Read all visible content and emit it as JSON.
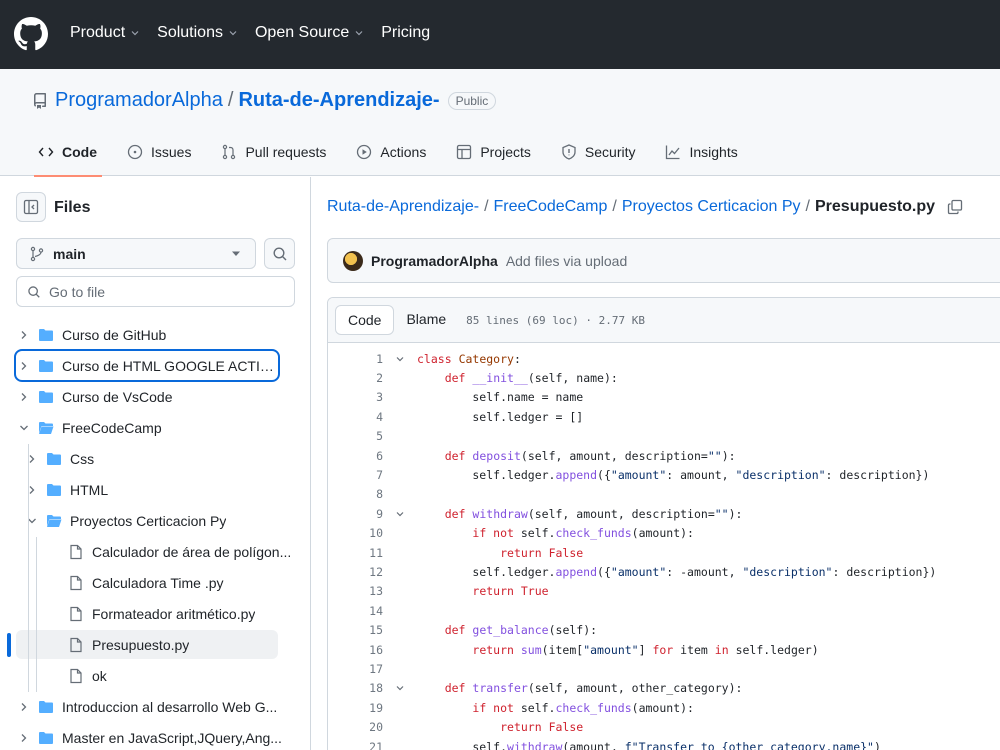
{
  "header": {
    "nav": [
      {
        "label": "Product",
        "dropdown": true
      },
      {
        "label": "Solutions",
        "dropdown": true
      },
      {
        "label": "Open Source",
        "dropdown": true
      },
      {
        "label": "Pricing",
        "dropdown": false
      }
    ]
  },
  "repo": {
    "owner": "ProgramadorAlpha",
    "separator": "/",
    "name": "Ruta-de-Aprendizaje-",
    "visibility": "Public"
  },
  "tabs": [
    {
      "label": "Code",
      "icon": "code-icon",
      "active": true
    },
    {
      "label": "Issues",
      "icon": "issue-icon"
    },
    {
      "label": "Pull requests",
      "icon": "pull-request-icon"
    },
    {
      "label": "Actions",
      "icon": "actions-icon"
    },
    {
      "label": "Projects",
      "icon": "projects-icon"
    },
    {
      "label": "Security",
      "icon": "shield-icon"
    },
    {
      "label": "Insights",
      "icon": "graph-icon"
    }
  ],
  "sidebar": {
    "title": "Files",
    "branch": "main",
    "goto_placeholder": "Go to file",
    "tree": [
      {
        "label": "Curso de GitHub",
        "type": "folder",
        "depth": 0,
        "expanded": false
      },
      {
        "label": "Curso de HTML GOOGLE ACTIVE",
        "type": "folder",
        "depth": 0,
        "expanded": false,
        "focused": true
      },
      {
        "label": "Curso de VsCode",
        "type": "folder",
        "depth": 0,
        "expanded": false
      },
      {
        "label": "FreeCodeCamp",
        "type": "folder",
        "depth": 0,
        "expanded": true
      },
      {
        "label": "Css",
        "type": "folder",
        "depth": 1,
        "expanded": false
      },
      {
        "label": "HTML",
        "type": "folder",
        "depth": 1,
        "expanded": false
      },
      {
        "label": "Proyectos Certicacion Py",
        "type": "folder",
        "depth": 1,
        "expanded": true
      },
      {
        "label": "Calculador de área de polígon...",
        "type": "file",
        "depth": 2
      },
      {
        "label": "Calculadora Time .py",
        "type": "file",
        "depth": 2
      },
      {
        "label": "Formateador aritmético.py",
        "type": "file",
        "depth": 2
      },
      {
        "label": "Presupuesto.py",
        "type": "file",
        "depth": 2,
        "selected": true
      },
      {
        "label": "ok",
        "type": "file",
        "depth": 2
      },
      {
        "label": "Introduccion al desarrollo Web G...",
        "type": "folder",
        "depth": 0,
        "expanded": false
      },
      {
        "label": "Master en JavaScript,JQuery,Ang...",
        "type": "folder",
        "depth": 0,
        "expanded": false
      }
    ]
  },
  "breadcrumb": {
    "parts": [
      "Ruta-de-Aprendizaje-",
      "FreeCodeCamp",
      "Proyectos Certicacion Py"
    ],
    "separator": "/",
    "current": "Presupuesto.py"
  },
  "commit": {
    "author": "ProgramadorAlpha",
    "message": "Add files via upload"
  },
  "code_view": {
    "view_code_label": "Code",
    "view_blame_label": "Blame",
    "file_info": "85 lines (69 loc) · 2.77 KB",
    "lines": [
      {
        "n": "1",
        "fold": true,
        "html": "<span class='kw'>class</span> <span class='cls'>Category</span>:"
      },
      {
        "n": "2",
        "fold": false,
        "html": "    <span class='kw'>def</span> <span class='fn'>__init__</span>(self, name):"
      },
      {
        "n": "3",
        "fold": false,
        "html": "        self.name = name"
      },
      {
        "n": "4",
        "fold": false,
        "html": "        self.ledger = []"
      },
      {
        "n": "5",
        "fold": false,
        "html": ""
      },
      {
        "n": "6",
        "fold": false,
        "html": "    <span class='kw'>def</span> <span class='fn'>deposit</span>(self, amount, description=<span class='str'>\"\"</span>):"
      },
      {
        "n": "7",
        "fold": false,
        "html": "        self.ledger.<span class='fn'>append</span>({<span class='str'>\"amount\"</span>: amount, <span class='str'>\"description\"</span>: description})"
      },
      {
        "n": "8",
        "fold": false,
        "html": ""
      },
      {
        "n": "9",
        "fold": true,
        "html": "    <span class='kw'>def</span> <span class='fn'>withdraw</span>(self, amount, description=<span class='str'>\"\"</span>):"
      },
      {
        "n": "10",
        "fold": false,
        "html": "        <span class='kw'>if not</span> self.<span class='fn'>check_funds</span>(amount):"
      },
      {
        "n": "11",
        "fold": false,
        "html": "            <span class='kw'>return</span> <span class='kw'>False</span>"
      },
      {
        "n": "12",
        "fold": false,
        "html": "        self.ledger.<span class='fn'>append</span>({<span class='str'>\"amount\"</span>: -amount, <span class='str'>\"description\"</span>: description})"
      },
      {
        "n": "13",
        "fold": false,
        "html": "        <span class='kw'>return</span> <span class='kw'>True</span>"
      },
      {
        "n": "14",
        "fold": false,
        "html": ""
      },
      {
        "n": "15",
        "fold": false,
        "html": "    <span class='kw'>def</span> <span class='fn'>get_balance</span>(self):"
      },
      {
        "n": "16",
        "fold": false,
        "html": "        <span class='kw'>return</span> <span class='fn'>sum</span>(item[<span class='str'>\"amount\"</span>] <span class='kw'>for</span> item <span class='kw'>in</span> self.ledger)"
      },
      {
        "n": "17",
        "fold": false,
        "html": ""
      },
      {
        "n": "18",
        "fold": true,
        "html": "    <span class='kw'>def</span> <span class='fn'>transfer</span>(self, amount, other_category):"
      },
      {
        "n": "19",
        "fold": false,
        "html": "        <span class='kw'>if not</span> self.<span class='fn'>check_funds</span>(amount):"
      },
      {
        "n": "20",
        "fold": false,
        "html": "            <span class='kw'>return</span> <span class='kw'>False</span>"
      },
      {
        "n": "21",
        "fold": false,
        "html": "        self.<span class='fn'>withdraw</span>(amount, <span class='str'>f\"Transfer to {other_category.name}\"</span>)"
      }
    ]
  },
  "colors": {
    "header_bg": "#24292f",
    "link": "#0969da",
    "tab_underline": "#fd8c73",
    "folder": "#54aeff"
  }
}
